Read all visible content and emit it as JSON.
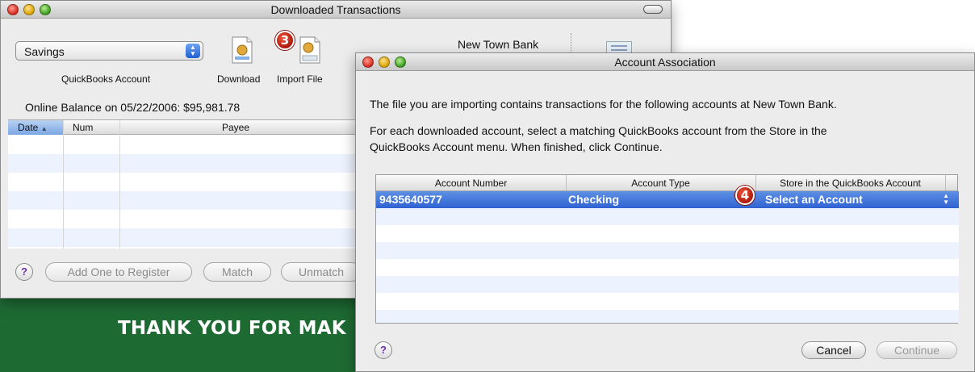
{
  "background": {
    "banner_text": "THANK YOU FOR MAK",
    "banner_color": "#1e6a33"
  },
  "downloaded_window": {
    "title": "Downloaded Transactions",
    "account_popup_value": "Savings",
    "account_popup_label": "QuickBooks Account",
    "toolbar": {
      "download_label": "Download",
      "import_label": "Import File",
      "bank_name": "New Town Bank"
    },
    "online_balance": "Online Balance on 05/22/2006: $95,981.78",
    "columns": [
      "Date",
      "Num",
      "Payee"
    ],
    "buttons": {
      "help": "?",
      "add_one": "Add One to Register",
      "match": "Match",
      "unmatch": "Unmatch"
    }
  },
  "association_window": {
    "title": "Account Association",
    "intro": "The file you are importing contains transactions for the following accounts at New Town Bank.",
    "instructions_line1": "For each downloaded account, select a matching QuickBooks account from the Store in the",
    "instructions_line2": "QuickBooks Account menu. When finished, click Continue.",
    "columns": [
      "Account Number",
      "Account Type",
      "Store in the QuickBooks Account"
    ],
    "rows": [
      {
        "account_number": "9435640577",
        "account_type": "Checking",
        "store_in": "Select an Account"
      }
    ],
    "buttons": {
      "help": "?",
      "cancel": "Cancel",
      "continue": "Continue"
    }
  },
  "badges": {
    "step3": "3",
    "step4": "4"
  },
  "colors": {
    "selection": "#2f63d2",
    "badge": "#c8200f"
  }
}
